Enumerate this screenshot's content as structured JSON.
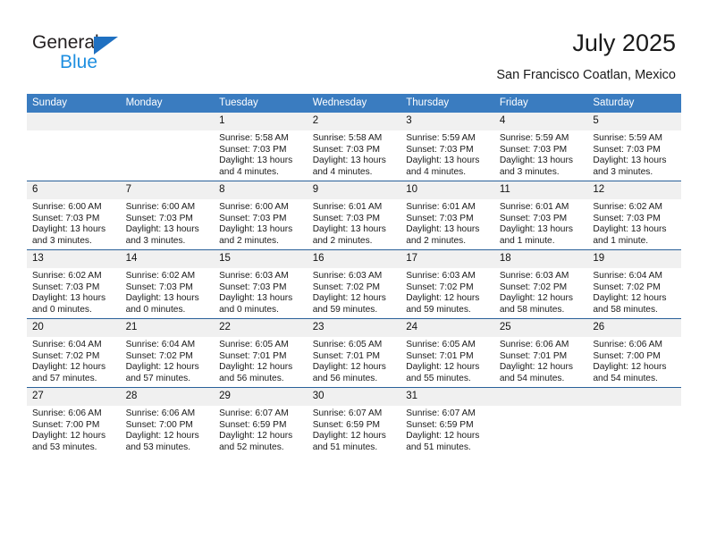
{
  "brand": {
    "line1": "General",
    "line2": "Blue",
    "triangle_icon": "brand-triangle-icon",
    "accent_dark": "#1f70c1",
    "accent_light": "#1f8fe0"
  },
  "header": {
    "title": "July 2025",
    "location": "San Francisco Coatlan, Mexico"
  },
  "theme": {
    "header_blue": "#3a7cc0",
    "row_divider": "#2a6099",
    "daynum_band": "#f0f0f0"
  },
  "weekdays": [
    "Sunday",
    "Monday",
    "Tuesday",
    "Wednesday",
    "Thursday",
    "Friday",
    "Saturday"
  ],
  "weeks": [
    [
      {
        "day": "",
        "blank": true,
        "sunrise": "",
        "sunset": "",
        "daylight1": "",
        "daylight2": ""
      },
      {
        "day": "",
        "blank": true,
        "sunrise": "",
        "sunset": "",
        "daylight1": "",
        "daylight2": ""
      },
      {
        "day": "1",
        "sunrise": "Sunrise: 5:58 AM",
        "sunset": "Sunset: 7:03 PM",
        "daylight1": "Daylight: 13 hours",
        "daylight2": "and 4 minutes."
      },
      {
        "day": "2",
        "sunrise": "Sunrise: 5:58 AM",
        "sunset": "Sunset: 7:03 PM",
        "daylight1": "Daylight: 13 hours",
        "daylight2": "and 4 minutes."
      },
      {
        "day": "3",
        "sunrise": "Sunrise: 5:59 AM",
        "sunset": "Sunset: 7:03 PM",
        "daylight1": "Daylight: 13 hours",
        "daylight2": "and 4 minutes."
      },
      {
        "day": "4",
        "sunrise": "Sunrise: 5:59 AM",
        "sunset": "Sunset: 7:03 PM",
        "daylight1": "Daylight: 13 hours",
        "daylight2": "and 3 minutes."
      },
      {
        "day": "5",
        "sunrise": "Sunrise: 5:59 AM",
        "sunset": "Sunset: 7:03 PM",
        "daylight1": "Daylight: 13 hours",
        "daylight2": "and 3 minutes."
      }
    ],
    [
      {
        "day": "6",
        "sunrise": "Sunrise: 6:00 AM",
        "sunset": "Sunset: 7:03 PM",
        "daylight1": "Daylight: 13 hours",
        "daylight2": "and 3 minutes."
      },
      {
        "day": "7",
        "sunrise": "Sunrise: 6:00 AM",
        "sunset": "Sunset: 7:03 PM",
        "daylight1": "Daylight: 13 hours",
        "daylight2": "and 3 minutes."
      },
      {
        "day": "8",
        "sunrise": "Sunrise: 6:00 AM",
        "sunset": "Sunset: 7:03 PM",
        "daylight1": "Daylight: 13 hours",
        "daylight2": "and 2 minutes."
      },
      {
        "day": "9",
        "sunrise": "Sunrise: 6:01 AM",
        "sunset": "Sunset: 7:03 PM",
        "daylight1": "Daylight: 13 hours",
        "daylight2": "and 2 minutes."
      },
      {
        "day": "10",
        "sunrise": "Sunrise: 6:01 AM",
        "sunset": "Sunset: 7:03 PM",
        "daylight1": "Daylight: 13 hours",
        "daylight2": "and 2 minutes."
      },
      {
        "day": "11",
        "sunrise": "Sunrise: 6:01 AM",
        "sunset": "Sunset: 7:03 PM",
        "daylight1": "Daylight: 13 hours",
        "daylight2": "and 1 minute."
      },
      {
        "day": "12",
        "sunrise": "Sunrise: 6:02 AM",
        "sunset": "Sunset: 7:03 PM",
        "daylight1": "Daylight: 13 hours",
        "daylight2": "and 1 minute."
      }
    ],
    [
      {
        "day": "13",
        "sunrise": "Sunrise: 6:02 AM",
        "sunset": "Sunset: 7:03 PM",
        "daylight1": "Daylight: 13 hours",
        "daylight2": "and 0 minutes."
      },
      {
        "day": "14",
        "sunrise": "Sunrise: 6:02 AM",
        "sunset": "Sunset: 7:03 PM",
        "daylight1": "Daylight: 13 hours",
        "daylight2": "and 0 minutes."
      },
      {
        "day": "15",
        "sunrise": "Sunrise: 6:03 AM",
        "sunset": "Sunset: 7:03 PM",
        "daylight1": "Daylight: 13 hours",
        "daylight2": "and 0 minutes."
      },
      {
        "day": "16",
        "sunrise": "Sunrise: 6:03 AM",
        "sunset": "Sunset: 7:02 PM",
        "daylight1": "Daylight: 12 hours",
        "daylight2": "and 59 minutes."
      },
      {
        "day": "17",
        "sunrise": "Sunrise: 6:03 AM",
        "sunset": "Sunset: 7:02 PM",
        "daylight1": "Daylight: 12 hours",
        "daylight2": "and 59 minutes."
      },
      {
        "day": "18",
        "sunrise": "Sunrise: 6:03 AM",
        "sunset": "Sunset: 7:02 PM",
        "daylight1": "Daylight: 12 hours",
        "daylight2": "and 58 minutes."
      },
      {
        "day": "19",
        "sunrise": "Sunrise: 6:04 AM",
        "sunset": "Sunset: 7:02 PM",
        "daylight1": "Daylight: 12 hours",
        "daylight2": "and 58 minutes."
      }
    ],
    [
      {
        "day": "20",
        "sunrise": "Sunrise: 6:04 AM",
        "sunset": "Sunset: 7:02 PM",
        "daylight1": "Daylight: 12 hours",
        "daylight2": "and 57 minutes."
      },
      {
        "day": "21",
        "sunrise": "Sunrise: 6:04 AM",
        "sunset": "Sunset: 7:02 PM",
        "daylight1": "Daylight: 12 hours",
        "daylight2": "and 57 minutes."
      },
      {
        "day": "22",
        "sunrise": "Sunrise: 6:05 AM",
        "sunset": "Sunset: 7:01 PM",
        "daylight1": "Daylight: 12 hours",
        "daylight2": "and 56 minutes."
      },
      {
        "day": "23",
        "sunrise": "Sunrise: 6:05 AM",
        "sunset": "Sunset: 7:01 PM",
        "daylight1": "Daylight: 12 hours",
        "daylight2": "and 56 minutes."
      },
      {
        "day": "24",
        "sunrise": "Sunrise: 6:05 AM",
        "sunset": "Sunset: 7:01 PM",
        "daylight1": "Daylight: 12 hours",
        "daylight2": "and 55 minutes."
      },
      {
        "day": "25",
        "sunrise": "Sunrise: 6:06 AM",
        "sunset": "Sunset: 7:01 PM",
        "daylight1": "Daylight: 12 hours",
        "daylight2": "and 54 minutes."
      },
      {
        "day": "26",
        "sunrise": "Sunrise: 6:06 AM",
        "sunset": "Sunset: 7:00 PM",
        "daylight1": "Daylight: 12 hours",
        "daylight2": "and 54 minutes."
      }
    ],
    [
      {
        "day": "27",
        "sunrise": "Sunrise: 6:06 AM",
        "sunset": "Sunset: 7:00 PM",
        "daylight1": "Daylight: 12 hours",
        "daylight2": "and 53 minutes."
      },
      {
        "day": "28",
        "sunrise": "Sunrise: 6:06 AM",
        "sunset": "Sunset: 7:00 PM",
        "daylight1": "Daylight: 12 hours",
        "daylight2": "and 53 minutes."
      },
      {
        "day": "29",
        "sunrise": "Sunrise: 6:07 AM",
        "sunset": "Sunset: 6:59 PM",
        "daylight1": "Daylight: 12 hours",
        "daylight2": "and 52 minutes."
      },
      {
        "day": "30",
        "sunrise": "Sunrise: 6:07 AM",
        "sunset": "Sunset: 6:59 PM",
        "daylight1": "Daylight: 12 hours",
        "daylight2": "and 51 minutes."
      },
      {
        "day": "31",
        "sunrise": "Sunrise: 6:07 AM",
        "sunset": "Sunset: 6:59 PM",
        "daylight1": "Daylight: 12 hours",
        "daylight2": "and 51 minutes."
      },
      {
        "day": "",
        "blank": true,
        "sunrise": "",
        "sunset": "",
        "daylight1": "",
        "daylight2": ""
      },
      {
        "day": "",
        "blank": true,
        "sunrise": "",
        "sunset": "",
        "daylight1": "",
        "daylight2": ""
      }
    ]
  ]
}
